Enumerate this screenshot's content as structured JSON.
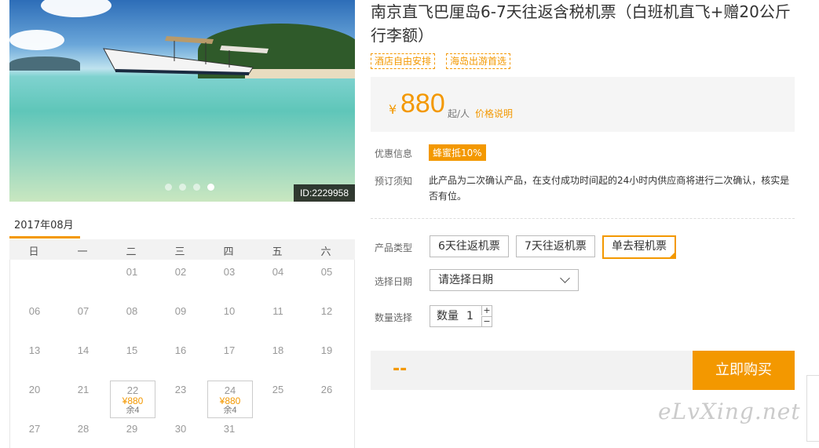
{
  "gallery": {
    "photo_id": "ID:2229958",
    "slides": 4,
    "active_slide": 4
  },
  "product": {
    "title": "南京直飞巴厘岛6-7天往返含税机票（白班机直飞+赠20公斤行李额）",
    "tags": [
      "酒店自由安排",
      "海岛出游首选"
    ]
  },
  "price": {
    "currency": "¥",
    "amount": "880",
    "unit": "起/人",
    "note_link": "价格说明"
  },
  "promo": {
    "label": "优惠信息",
    "badge": "蜂蜜抵10%"
  },
  "notice": {
    "label": "预订须知",
    "text": "此产品为二次确认产品，在支付成功时间起的24小时内供应商将进行二次确认，核实是否有位。"
  },
  "product_type": {
    "label": "产品类型",
    "options": [
      "6天往返机票",
      "7天往返机票",
      "单去程机票"
    ],
    "selected": 2
  },
  "date_select": {
    "label": "选择日期",
    "placeholder": "请选择日期"
  },
  "quantity": {
    "label": "数量选择",
    "field_label": "数量",
    "value": "1",
    "plus": "+",
    "minus": "−"
  },
  "purchase": {
    "total": "--",
    "buy_label": "立即购买"
  },
  "calendar": {
    "month": "2017年08月",
    "weekdays": [
      "日",
      "一",
      "二",
      "三",
      "四",
      "五",
      "六"
    ],
    "weeks": [
      [
        "",
        "",
        "01",
        "02",
        "03",
        "04",
        "05"
      ],
      [
        "06",
        "07",
        "08",
        "09",
        "10",
        "11",
        "12"
      ],
      [
        "13",
        "14",
        "15",
        "16",
        "17",
        "18",
        "19"
      ],
      [
        "20",
        "21",
        "22",
        "23",
        "24",
        "25",
        "26"
      ],
      [
        "27",
        "28",
        "29",
        "30",
        "31",
        "",
        ""
      ]
    ],
    "available": [
      {
        "day": "22",
        "price": "¥880",
        "remaining": "余4"
      },
      {
        "day": "24",
        "price": "¥880",
        "remaining": "余4"
      }
    ]
  },
  "watermark": "eLvXing.net",
  "colors": {
    "accent": "#f39800",
    "panel": "#f5f5f5"
  }
}
